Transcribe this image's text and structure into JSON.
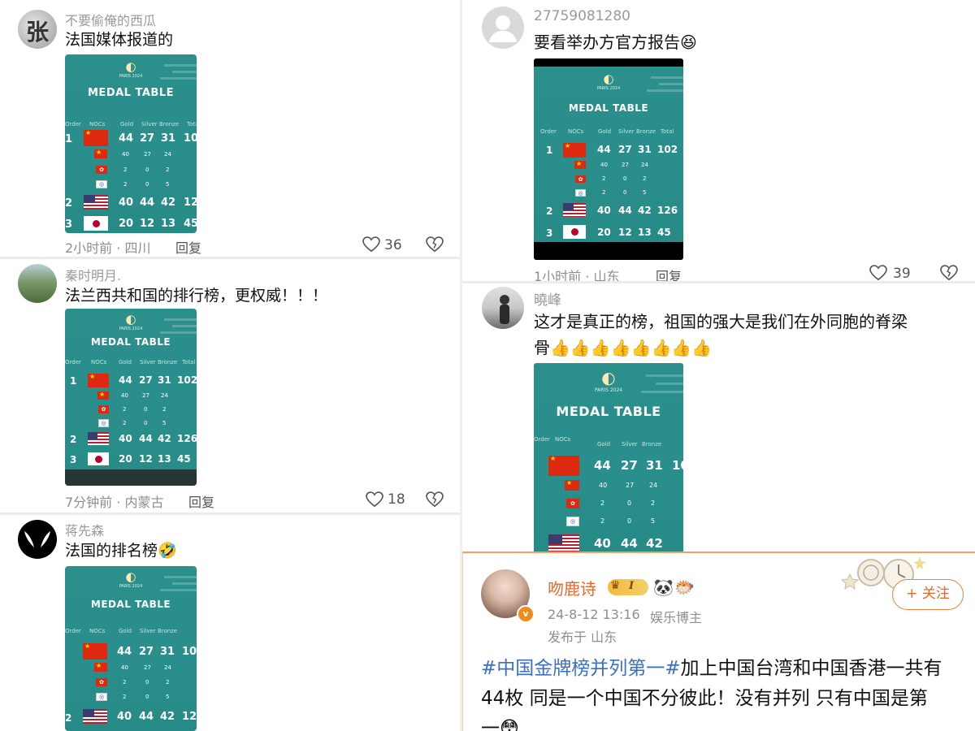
{
  "comments": [
    {
      "username": "不要偷俺的西瓜",
      "avatar_text": "张",
      "text": "法国媒体报道的",
      "time_location": "2小时前 · 四川",
      "reply_label": "回复",
      "likes": "36",
      "medal_table": {
        "title": "MEDAL TABLE",
        "logo_text": "PARIS 2024"
      }
    },
    {
      "username": "27759081280",
      "text": "要看举办方官方报告😆",
      "time_location": "1小时前 · 山东",
      "reply_label": "回复",
      "likes": "39",
      "medal_table": {
        "title": "MEDAL TABLE",
        "logo_text": "PARIS 2024"
      }
    },
    {
      "username": "秦时明月.",
      "text": "法兰西共和国的排行榜，更权威！！！",
      "time_location": "7分钟前 · 内蒙古",
      "reply_label": "回复",
      "likes": "18",
      "medal_table": {
        "title": "MEDAL TABLE",
        "logo_text": "PARIS 2024"
      }
    },
    {
      "username": "曉峰",
      "text_line1": "这才是真正的榜，祖国的强大是我们在外同胞的脊梁",
      "text_line2": "骨👍👍👍👍👍👍👍👍",
      "medal_table": {
        "title": "MEDAL TABLE",
        "logo_text": "PARIS 2024"
      }
    },
    {
      "username": "蒋先森",
      "text": "法国的排名榜🤣",
      "medal_table": {
        "title": "MEDAL TABLE",
        "logo_text": "PARIS 2024"
      }
    }
  ],
  "medal_table_data": {
    "headers": {
      "order": "Order",
      "noc": "NOCs",
      "gold": "Gold",
      "silver": "Silver",
      "bronze": "Bronze",
      "total": "Total"
    },
    "rows": [
      {
        "rank": "1",
        "flag": "china",
        "gold": "44",
        "silver": "27",
        "bronze": "31",
        "total": "102"
      },
      {
        "rank": "",
        "flag": "china",
        "gold": "40",
        "silver": "27",
        "bronze": "24",
        "total": ""
      },
      {
        "rank": "",
        "flag": "hong-kong",
        "gold": "2",
        "silver": "0",
        "bronze": "2",
        "total": ""
      },
      {
        "rank": "",
        "flag": "chinese-taipei",
        "gold": "2",
        "silver": "0",
        "bronze": "5",
        "total": ""
      },
      {
        "rank": "2",
        "flag": "usa",
        "gold": "40",
        "silver": "44",
        "bronze": "42",
        "total": "126"
      },
      {
        "rank": "3",
        "flag": "japan",
        "gold": "20",
        "silver": "12",
        "bronze": "13",
        "total": "45"
      }
    ],
    "truncated_total_1": "10",
    "truncated_total_2": "12"
  },
  "weibo_post": {
    "author": "吻鹿诗",
    "level_badge": "I",
    "date": "24-8-12 13:16",
    "role": "娱乐博主",
    "location": "发布于 山东",
    "follow_label": "+ 关注",
    "hashtag": "#中国金牌榜并列第一#",
    "text_part1": "加上中国台湾和中国香港一共有",
    "text_line2": "44枚 同是一个中国不分彼此！没有并列 只有中国是第",
    "text_line3": "一😳"
  },
  "colors": {
    "medal_bg": "#2a8f8c",
    "accent_orange": "#e8662a",
    "hashtag_blue": "#3a6fc4"
  }
}
